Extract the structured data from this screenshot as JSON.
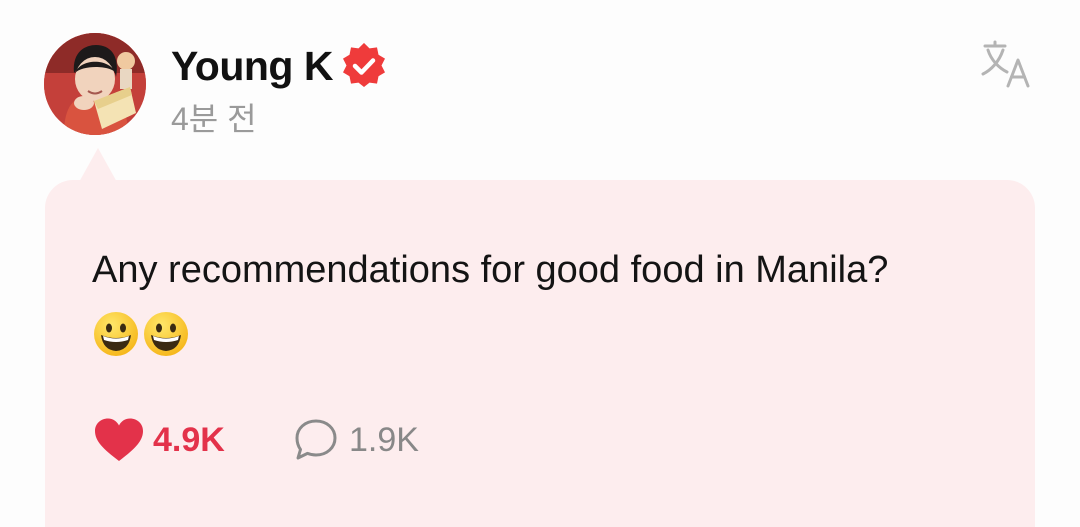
{
  "author": {
    "name": "Young K",
    "verified": true,
    "time": "4분 전"
  },
  "post": {
    "text": "Any recommendations for good food in Manila?",
    "emojis": [
      "grinning-face",
      "grinning-face"
    ]
  },
  "actions": {
    "likes": "4.9K",
    "comments": "1.9K"
  },
  "icons": {
    "verified": "verified-badge-icon",
    "translate": "translate-icon",
    "like": "heart-icon",
    "comment": "speech-bubble-icon"
  },
  "colors": {
    "bubble_background": "#fdedee",
    "accent_red": "#e3324a",
    "muted_text": "#9a9a9a",
    "primary_text": "#141414"
  }
}
